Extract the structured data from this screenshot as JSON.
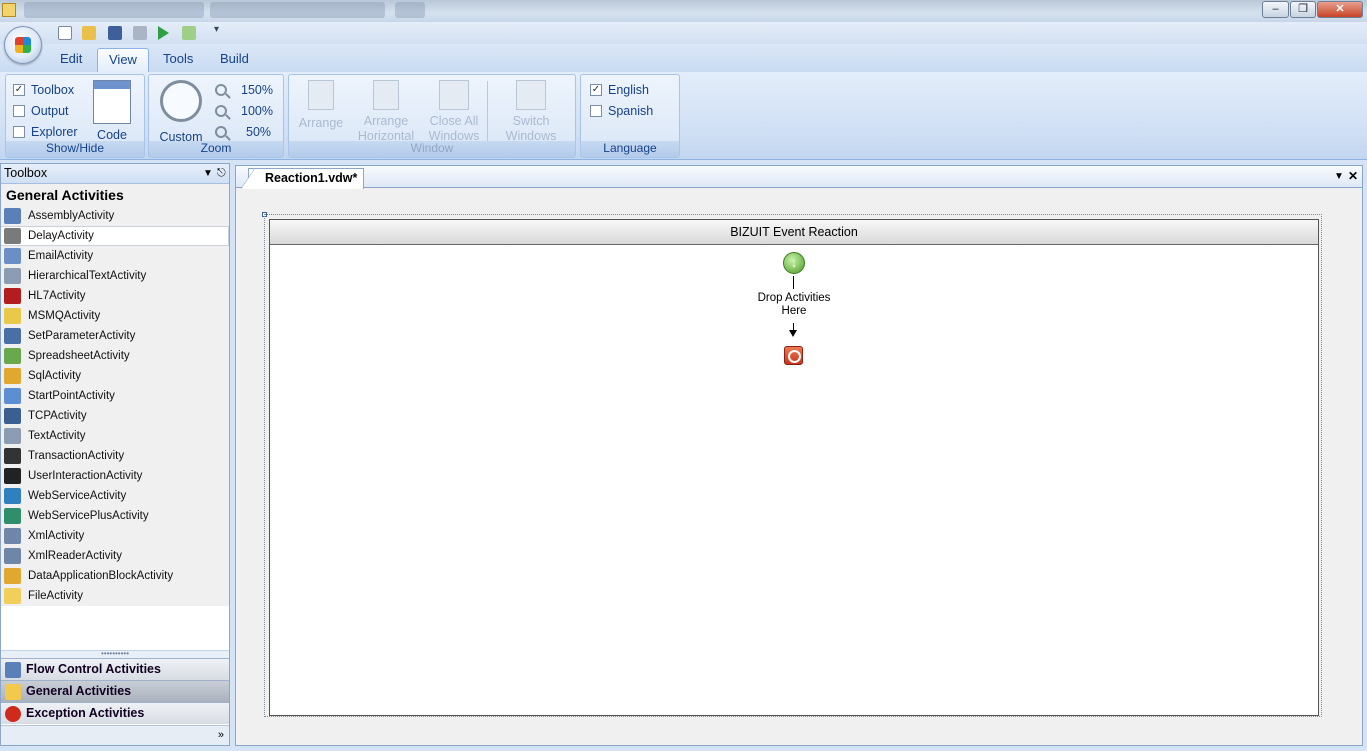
{
  "ribbon": {
    "tabs": [
      {
        "label": "Edit",
        "active": false
      },
      {
        "label": "View",
        "active": true
      },
      {
        "label": "Tools",
        "active": false
      },
      {
        "label": "Build",
        "active": false
      }
    ],
    "show_hide": {
      "group_label": "Show/Hide",
      "toolbox": {
        "label": "Toolbox",
        "checked": true
      },
      "output": {
        "label": "Output",
        "checked": false
      },
      "explorer": {
        "label": "Explorer",
        "checked": false
      },
      "code_label": "Code"
    },
    "zoom": {
      "group_label": "Zoom",
      "custom_label": "Custom",
      "levels": [
        "150%",
        "100%",
        "50%"
      ]
    },
    "window": {
      "group_label": "Window",
      "arrange": "Arrange",
      "arrange_horizontal": [
        "Arrange",
        "Horizontal"
      ],
      "close_all": [
        "Close All",
        "Windows"
      ],
      "switch": [
        "Switch",
        "Windows"
      ]
    },
    "language": {
      "group_label": "Language",
      "english": {
        "label": "English",
        "checked": true
      },
      "spanish": {
        "label": "Spanish",
        "checked": false
      }
    }
  },
  "toolbox": {
    "title": "Toolbox",
    "section_title": "General Activities",
    "items": [
      {
        "label": "AssemblyActivity",
        "icon": "assembly-icon",
        "color": "#5b7fb8"
      },
      {
        "label": "DelayActivity",
        "icon": "stopwatch-icon",
        "color": "#7a7a7a"
      },
      {
        "label": "EmailActivity",
        "icon": "email-icon",
        "color": "#6b8fc4"
      },
      {
        "label": "HierarchicalTextActivity",
        "icon": "document-icon",
        "color": "#8b9cb3"
      },
      {
        "label": "HL7Activity",
        "icon": "hl7-icon",
        "color": "#b31d1d"
      },
      {
        "label": "MSMQActivity",
        "icon": "envelope-icon",
        "color": "#e8c94a"
      },
      {
        "label": "SetParameterActivity",
        "icon": "parameter-icon",
        "color": "#4a6fa5"
      },
      {
        "label": "SpreadsheetActivity",
        "icon": "spreadsheet-icon",
        "color": "#6aa84f"
      },
      {
        "label": "SqlActivity",
        "icon": "database-icon",
        "color": "#e0a82e"
      },
      {
        "label": "StartPointActivity",
        "icon": "start-point-icon",
        "color": "#5b8fd1"
      },
      {
        "label": "TCPActivity",
        "icon": "network-icon",
        "color": "#3c5f91"
      },
      {
        "label": "TextActivity",
        "icon": "text-icon",
        "color": "#8b9cb3"
      },
      {
        "label": "TransactionActivity",
        "icon": "transaction-icon",
        "color": "#333333"
      },
      {
        "label": "UserInteractionActivity",
        "icon": "user-icon",
        "color": "#222222"
      },
      {
        "label": "WebServiceActivity",
        "icon": "globe-icon",
        "color": "#2f7fc1"
      },
      {
        "label": "WebServicePlusActivity",
        "icon": "globe-plus-icon",
        "color": "#2f8f6a"
      },
      {
        "label": "XmlActivity",
        "icon": "xml-icon",
        "color": "#6f86a8"
      },
      {
        "label": "XmlReaderActivity",
        "icon": "xml-reader-icon",
        "color": "#6f86a8"
      },
      {
        "label": "DataApplicationBlockActivity",
        "icon": "database-icon",
        "color": "#e0a82e"
      },
      {
        "label": "FileActivity",
        "icon": "folder-icon",
        "color": "#f0cf5a"
      }
    ],
    "selected_index": 1,
    "categories": [
      {
        "label": "Flow Control Activities",
        "icon": "flow-control-icon",
        "color": "#5b7fb8",
        "active": false
      },
      {
        "label": "General Activities",
        "icon": "general-activities-icon",
        "color": "#f2c94c",
        "active": true
      },
      {
        "label": "Exception Activities",
        "icon": "exception-icon",
        "color": "#d02a1c",
        "active": false
      }
    ]
  },
  "document": {
    "tab_label": "Reaction1.vdw*",
    "workflow_title": "BIZUIT Event Reaction",
    "drop_text_line1": "Drop Activities",
    "drop_text_line2": "Here"
  }
}
